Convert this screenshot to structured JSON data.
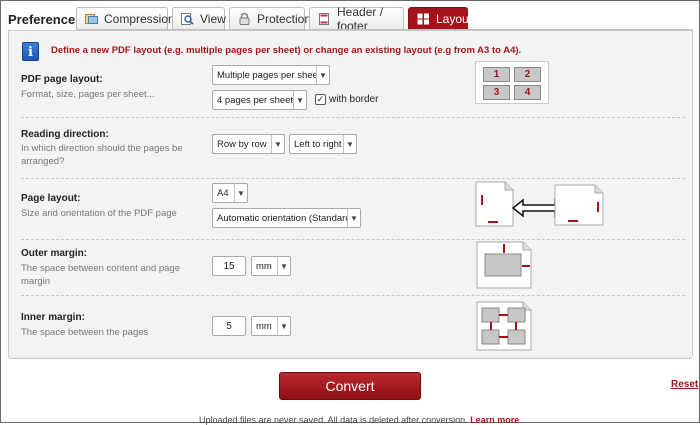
{
  "preferences_label": "Preferences:",
  "tabs": [
    {
      "label": "Compression",
      "icon": "compression-icon"
    },
    {
      "label": "View",
      "icon": "view-icon"
    },
    {
      "label": "Protection",
      "icon": "protection-icon"
    },
    {
      "label": "Header / footer",
      "icon": "header-footer-icon"
    },
    {
      "label": "Layout",
      "icon": "layout-icon",
      "active": true
    }
  ],
  "info": {
    "icon": "info-icon",
    "text": "Define a new PDF layout (e.g. multiple pages per sheet) or change an existing layout (e.g from A3 to A4)."
  },
  "rows": {
    "pdf_page_layout": {
      "title": "PDF page layout:",
      "subtitle": "Format, size, pages per sheet...",
      "mode_select": "Multiple pages per sheet",
      "pages_select": "4 pages per sheet",
      "with_border_label": "with border",
      "with_border_checked": true,
      "grid_numbers": [
        "1",
        "2",
        "3",
        "4"
      ]
    },
    "reading_direction": {
      "title": "Reading direction:",
      "subtitle": "In which direction should the pages be arranged?",
      "order_select": "Row by row",
      "direction_select": "Left to right"
    },
    "page_layout": {
      "title": "Page layout:",
      "subtitle": "Size and orientation of the PDF page",
      "size_select": "A4",
      "orientation_select": "Automatic orientation (Standard)"
    },
    "outer_margin": {
      "title": "Outer margin:",
      "subtitle": "The space between content and page margin",
      "value": "15",
      "unit": "mm"
    },
    "inner_margin": {
      "title": "Inner margin:",
      "subtitle": "The space between the pages",
      "value": "5",
      "unit": "mm"
    }
  },
  "convert_label": "Convert",
  "reset_label": "Reset",
  "footer": {
    "text": "Uploaded files are never saved. All data is deleted after conversion.",
    "link": "Learn more"
  },
  "colors": {
    "accent": "#a4151b",
    "panel_bg": "#f3f3f3"
  }
}
